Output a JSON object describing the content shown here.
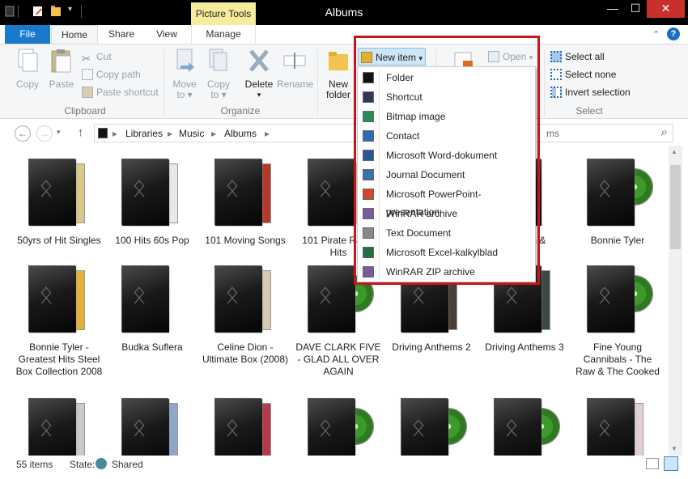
{
  "window": {
    "title": "Albums",
    "context_tab": "Picture Tools",
    "minimize": "—",
    "maximize": "☐",
    "close": "✕"
  },
  "tabs": {
    "file": "File",
    "home": "Home",
    "share": "Share",
    "view": "View",
    "manage": "Manage",
    "help": "?"
  },
  "ribbon": {
    "clipboard": {
      "copy": "Copy",
      "paste": "Paste",
      "cut": "Cut",
      "copy_path": "Copy path",
      "paste_shortcut": "Paste shortcut",
      "label": "Clipboard"
    },
    "organize": {
      "move_to_line1": "Move",
      "move_to_line2": "to ▾",
      "copy_to_line1": "Copy",
      "copy_to_line2": "to ▾",
      "delete": "Delete",
      "delete_arrow": "▾",
      "rename": "Rename",
      "label": "Organize"
    },
    "new": {
      "new_folder_line1": "New",
      "new_folder_line2": "folder",
      "new_item": "New item",
      "new_item_arrow": "▾"
    },
    "open": {
      "open": "Open",
      "open_arrow": "▾"
    },
    "select": {
      "select_all": "Select all",
      "select_none": "Select none",
      "invert_selection": "Invert selection",
      "label": "Select"
    }
  },
  "nav": {
    "back": "←",
    "forward": "→",
    "up": "↑",
    "breadcrumb": [
      "Libraries",
      "Music",
      "Albums"
    ],
    "separator": "▸",
    "search_placeholder": "ms",
    "search_icon": "⌕"
  },
  "items": [
    {
      "label": "50yrs of Hit Singles",
      "art": "page",
      "color": "#d9c98b"
    },
    {
      "label": "100 Hits 60s Pop",
      "art": "page",
      "color": "#e8e8e8"
    },
    {
      "label": "101 Moving Songs",
      "art": "page",
      "color": "#b33a2a"
    },
    {
      "label": "101 Pirate Radio Hits",
      "art": "page",
      "color": "#c9c2a8"
    },
    {
      "label": "",
      "art": "none",
      "color": "#fff"
    },
    {
      "label": "Anthem &",
      "art": "none",
      "color": "#fff"
    },
    {
      "label": "Bonnie Tyler",
      "art": "disc",
      "color": "#3c9a2b"
    },
    {
      "label": "Bonnie Tyler - Greatest Hits Steel Box Collection 2008",
      "art": "page",
      "color": "#e2b33a"
    },
    {
      "label": "Budka Suflera",
      "art": "none",
      "color": "#fff"
    },
    {
      "label": "Celine Dion - Ultimate Box (2008)",
      "art": "page",
      "color": "#d6c9b6"
    },
    {
      "label": "DAVE CLARK FIVE - GLAD ALL OVER AGAIN",
      "art": "disc",
      "color": "#3c9a2b"
    },
    {
      "label": "Driving Anthems 2",
      "art": "page",
      "color": "#4a3f37"
    },
    {
      "label": "Driving Anthems 3",
      "art": "page",
      "color": "#3b4a44"
    },
    {
      "label": "Fine Young Cannibals - The Raw & The Cooked",
      "art": "disc",
      "color": "#3c9a2b"
    },
    {
      "label": "",
      "art": "page",
      "color": "#c9c9c9"
    },
    {
      "label": "",
      "art": "page",
      "color": "#8fa7c6"
    },
    {
      "label": "",
      "art": "page",
      "color": "#b53a4a"
    },
    {
      "label": "",
      "art": "disc",
      "color": "#3c9a2b"
    },
    {
      "label": "",
      "art": "disc",
      "color": "#3c9a2b"
    },
    {
      "label": "",
      "art": "disc",
      "color": "#3c9a2b"
    },
    {
      "label": "",
      "art": "page",
      "color": "#e0d0d0"
    }
  ],
  "menu": {
    "items": [
      {
        "label": "Folder",
        "icon": "folder-icon",
        "color": "#111"
      },
      {
        "label": "Shortcut",
        "icon": "shortcut-icon",
        "color": "#2e3a5a"
      },
      {
        "label": "Bitmap image",
        "icon": "bitmap-icon",
        "color": "#2a8a5a"
      },
      {
        "label": "Contact",
        "icon": "contact-icon",
        "color": "#2b6cb0"
      },
      {
        "label": "Microsoft Word-dokument",
        "icon": "word-icon",
        "color": "#2b5797"
      },
      {
        "label": "Journal Document",
        "icon": "journal-icon",
        "color": "#3a6fb0"
      },
      {
        "label": "Microsoft PowerPoint-presentation",
        "icon": "powerpoint-icon",
        "color": "#d24726"
      },
      {
        "label": "WinRAR archive",
        "icon": "winrar-icon",
        "color": "#7a5a9a"
      },
      {
        "label": "Text Document",
        "icon": "text-icon",
        "color": "#888"
      },
      {
        "label": "Microsoft Excel-kalkylblad",
        "icon": "excel-icon",
        "color": "#1e7145"
      },
      {
        "label": "WinRAR ZIP archive",
        "icon": "winrar-zip-icon",
        "color": "#7a5a9a"
      }
    ]
  },
  "status": {
    "count": "55 items",
    "state_label": "State:",
    "state_value": "Shared"
  },
  "colors": {
    "accent": "#1979ca",
    "highlight": "#c8141c",
    "context_tab": "#f6ec9d"
  }
}
